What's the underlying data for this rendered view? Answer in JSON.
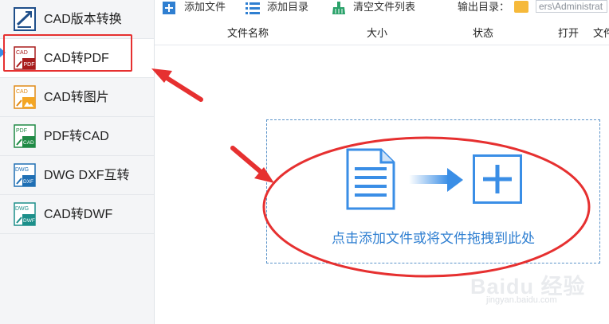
{
  "sidebar": {
    "items": [
      {
        "label": "CAD版本转换",
        "icon": "cad-version-icon"
      },
      {
        "label": "CAD转PDF",
        "icon": "cad-to-pdf-icon",
        "active": true
      },
      {
        "label": "CAD转图片",
        "icon": "cad-to-image-icon"
      },
      {
        "label": "PDF转CAD",
        "icon": "pdf-to-cad-icon"
      },
      {
        "label": "DWG DXF互转",
        "icon": "dwg-dxf-icon"
      },
      {
        "label": "CAD转DWF",
        "icon": "cad-to-dwf-icon"
      }
    ],
    "icon_text": {
      "cad": "CAD",
      "pdf": "PDF",
      "dwg": "DWG",
      "dxf": "DXF",
      "dwf": "DWF"
    }
  },
  "toolbar": {
    "add_file": "添加文件",
    "add_folder": "添加目录",
    "clear_list": "清空文件列表",
    "output_dir_label": "输出目录：",
    "output_path": "ers\\Administrat"
  },
  "table": {
    "columns": [
      "文件名称",
      "大小",
      "状态",
      "打开",
      "文件"
    ]
  },
  "dropzone": {
    "text": "点击添加文件或将文件拖拽到此处"
  },
  "watermark": {
    "line1": "Baidu 经验",
    "line2": "jingyan.baidu.com"
  },
  "colors": {
    "accent": "#2f7fd1",
    "annotation": "#e63030",
    "sidebar_bg": "#f4f5f7"
  }
}
